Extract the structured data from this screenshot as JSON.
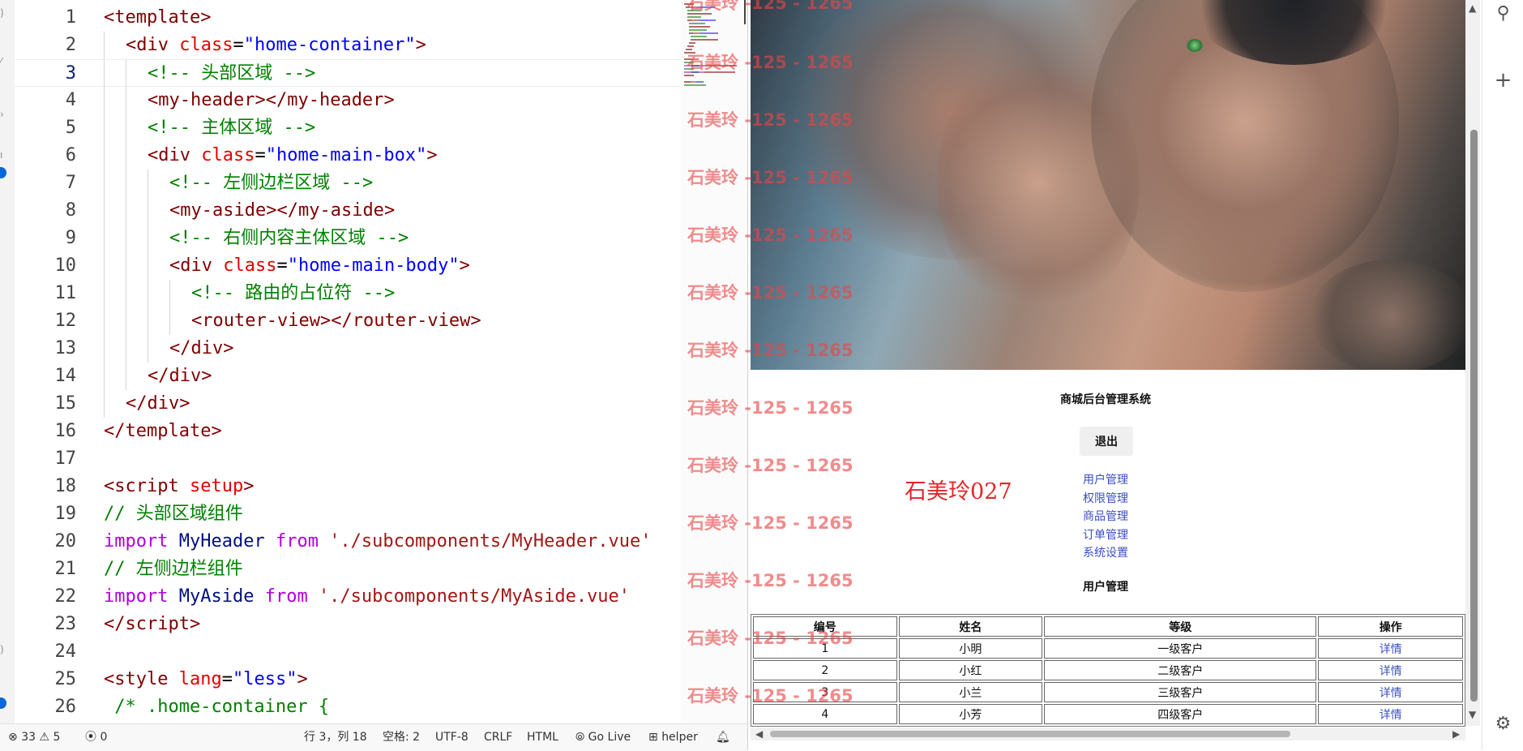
{
  "editor": {
    "lines": [
      {
        "n": "1",
        "indent": 0,
        "tokens": [
          [
            "t-punc",
            "<"
          ],
          [
            "t-tag",
            "template"
          ],
          [
            "t-punc",
            ">"
          ]
        ]
      },
      {
        "n": "2",
        "indent": 1,
        "tokens": [
          [
            "t-punc",
            "<"
          ],
          [
            "t-tag",
            "div"
          ],
          [
            "t-plain",
            " "
          ],
          [
            "t-attr",
            "class"
          ],
          [
            "t-plain",
            "="
          ],
          [
            "t-str",
            "\"home-container\""
          ],
          [
            "t-punc",
            ">"
          ]
        ]
      },
      {
        "n": "3",
        "indent": 2,
        "current": true,
        "tokens": [
          [
            "t-comm",
            "<!-- 头部区域 -->"
          ]
        ]
      },
      {
        "n": "4",
        "indent": 2,
        "tokens": [
          [
            "t-punc",
            "<"
          ],
          [
            "t-tag",
            "my-header"
          ],
          [
            "t-punc",
            "></"
          ],
          [
            "t-tag",
            "my-header"
          ],
          [
            "t-punc",
            ">"
          ]
        ]
      },
      {
        "n": "5",
        "indent": 2,
        "tokens": [
          [
            "t-comm",
            "<!-- 主体区域 -->"
          ]
        ]
      },
      {
        "n": "6",
        "indent": 2,
        "tokens": [
          [
            "t-punc",
            "<"
          ],
          [
            "t-tag",
            "div"
          ],
          [
            "t-plain",
            " "
          ],
          [
            "t-attr",
            "class"
          ],
          [
            "t-plain",
            "="
          ],
          [
            "t-str",
            "\"home-main-box\""
          ],
          [
            "t-punc",
            ">"
          ]
        ]
      },
      {
        "n": "7",
        "indent": 3,
        "tokens": [
          [
            "t-comm",
            "<!-- 左侧边栏区域 -->"
          ]
        ]
      },
      {
        "n": "8",
        "indent": 3,
        "tokens": [
          [
            "t-punc",
            "<"
          ],
          [
            "t-tag",
            "my-aside"
          ],
          [
            "t-punc",
            "></"
          ],
          [
            "t-tag",
            "my-aside"
          ],
          [
            "t-punc",
            ">"
          ]
        ]
      },
      {
        "n": "9",
        "indent": 3,
        "tokens": [
          [
            "t-comm",
            "<!-- 右侧内容主体区域 -->"
          ]
        ]
      },
      {
        "n": "10",
        "indent": 3,
        "tokens": [
          [
            "t-punc",
            "<"
          ],
          [
            "t-tag",
            "div"
          ],
          [
            "t-plain",
            " "
          ],
          [
            "t-attr",
            "class"
          ],
          [
            "t-plain",
            "="
          ],
          [
            "t-str",
            "\"home-main-body\""
          ],
          [
            "t-punc",
            ">"
          ]
        ]
      },
      {
        "n": "11",
        "indent": 4,
        "tokens": [
          [
            "t-comm",
            "<!-- 路由的占位符 -->"
          ]
        ]
      },
      {
        "n": "12",
        "indent": 4,
        "tokens": [
          [
            "t-punc",
            "<"
          ],
          [
            "t-tag",
            "router-view"
          ],
          [
            "t-punc",
            "></"
          ],
          [
            "t-tag",
            "router-view"
          ],
          [
            "t-punc",
            ">"
          ]
        ]
      },
      {
        "n": "13",
        "indent": 3,
        "tokens": [
          [
            "t-punc",
            "</"
          ],
          [
            "t-tag",
            "div"
          ],
          [
            "t-punc",
            ">"
          ]
        ]
      },
      {
        "n": "14",
        "indent": 2,
        "tokens": [
          [
            "t-punc",
            "</"
          ],
          [
            "t-tag",
            "div"
          ],
          [
            "t-punc",
            ">"
          ]
        ]
      },
      {
        "n": "15",
        "indent": 1,
        "tokens": [
          [
            "t-punc",
            "</"
          ],
          [
            "t-tag",
            "div"
          ],
          [
            "t-punc",
            ">"
          ]
        ]
      },
      {
        "n": "16",
        "indent": 0,
        "tokens": [
          [
            "t-punc",
            "</"
          ],
          [
            "t-tag",
            "template"
          ],
          [
            "t-punc",
            ">"
          ]
        ]
      },
      {
        "n": "17",
        "indent": 0,
        "tokens": []
      },
      {
        "n": "18",
        "indent": 0,
        "tokens": [
          [
            "t-punc",
            "<"
          ],
          [
            "t-tag",
            "script"
          ],
          [
            "t-plain",
            " "
          ],
          [
            "t-attr",
            "setup"
          ],
          [
            "t-punc",
            ">"
          ]
        ]
      },
      {
        "n": "19",
        "indent": 0,
        "tokens": [
          [
            "t-comm",
            "// 头部区域组件"
          ]
        ]
      },
      {
        "n": "20",
        "indent": 0,
        "tokens": [
          [
            "t-kw",
            "import"
          ],
          [
            "t-plain",
            " "
          ],
          [
            "t-id",
            "MyHeader"
          ],
          [
            "t-plain",
            " "
          ],
          [
            "t-kw",
            "from"
          ],
          [
            "t-plain",
            " "
          ],
          [
            "t-path",
            "'./subcomponents/MyHeader.vue'"
          ]
        ]
      },
      {
        "n": "21",
        "indent": 0,
        "tokens": [
          [
            "t-comm",
            "// 左侧边栏组件"
          ]
        ]
      },
      {
        "n": "22",
        "indent": 0,
        "tokens": [
          [
            "t-kw",
            "import"
          ],
          [
            "t-plain",
            " "
          ],
          [
            "t-id",
            "MyAside"
          ],
          [
            "t-plain",
            " "
          ],
          [
            "t-kw",
            "from"
          ],
          [
            "t-plain",
            " "
          ],
          [
            "t-path",
            "'./subcomponents/MyAside.vue'"
          ]
        ]
      },
      {
        "n": "23",
        "indent": 0,
        "tokens": [
          [
            "t-punc",
            "</"
          ],
          [
            "t-tag",
            "script"
          ],
          [
            "t-punc",
            ">"
          ]
        ]
      },
      {
        "n": "24",
        "indent": 0,
        "tokens": []
      },
      {
        "n": "25",
        "indent": 0,
        "tokens": [
          [
            "t-punc",
            "<"
          ],
          [
            "t-tag",
            "style"
          ],
          [
            "t-plain",
            " "
          ],
          [
            "t-attr",
            "lang"
          ],
          [
            "t-plain",
            "="
          ],
          [
            "t-str",
            "\"less\""
          ],
          [
            "t-punc",
            ">"
          ]
        ]
      },
      {
        "n": "26",
        "indent": 0,
        "tokens": [
          [
            "t-comm",
            " /* .home-container {"
          ]
        ]
      }
    ]
  },
  "status_bar": {
    "errors": "33",
    "warnings": "5",
    "ports": "0",
    "position": "行 3，列 18",
    "spaces": "空格: 2",
    "encoding": "UTF-8",
    "eol": "CRLF",
    "language": "HTML",
    "go_live": "Go Live",
    "helper": "helper"
  },
  "browser": {
    "app_title": "商城后台管理系统",
    "logout_label": "退出",
    "nav": [
      "用户管理",
      "权限管理",
      "商品管理",
      "订单管理",
      "系统设置"
    ],
    "section_heading": "用户管理",
    "table": {
      "headers": [
        "编号",
        "姓名",
        "等级",
        "操作"
      ],
      "rows": [
        [
          "1",
          "小明",
          "一级客户",
          "详情"
        ],
        [
          "2",
          "小红",
          "二级客户",
          "详情"
        ],
        [
          "3",
          "小兰",
          "三级客户",
          "详情"
        ],
        [
          "4",
          "小芳",
          "四级客户",
          "详情"
        ]
      ]
    },
    "watermark_name": "石美玲027"
  },
  "watermark": {
    "text": "石美玲 -125 - 1265",
    "color": "#e64646"
  },
  "colors": {
    "link": "#3b4ec4",
    "badge": "#0a66d8"
  }
}
